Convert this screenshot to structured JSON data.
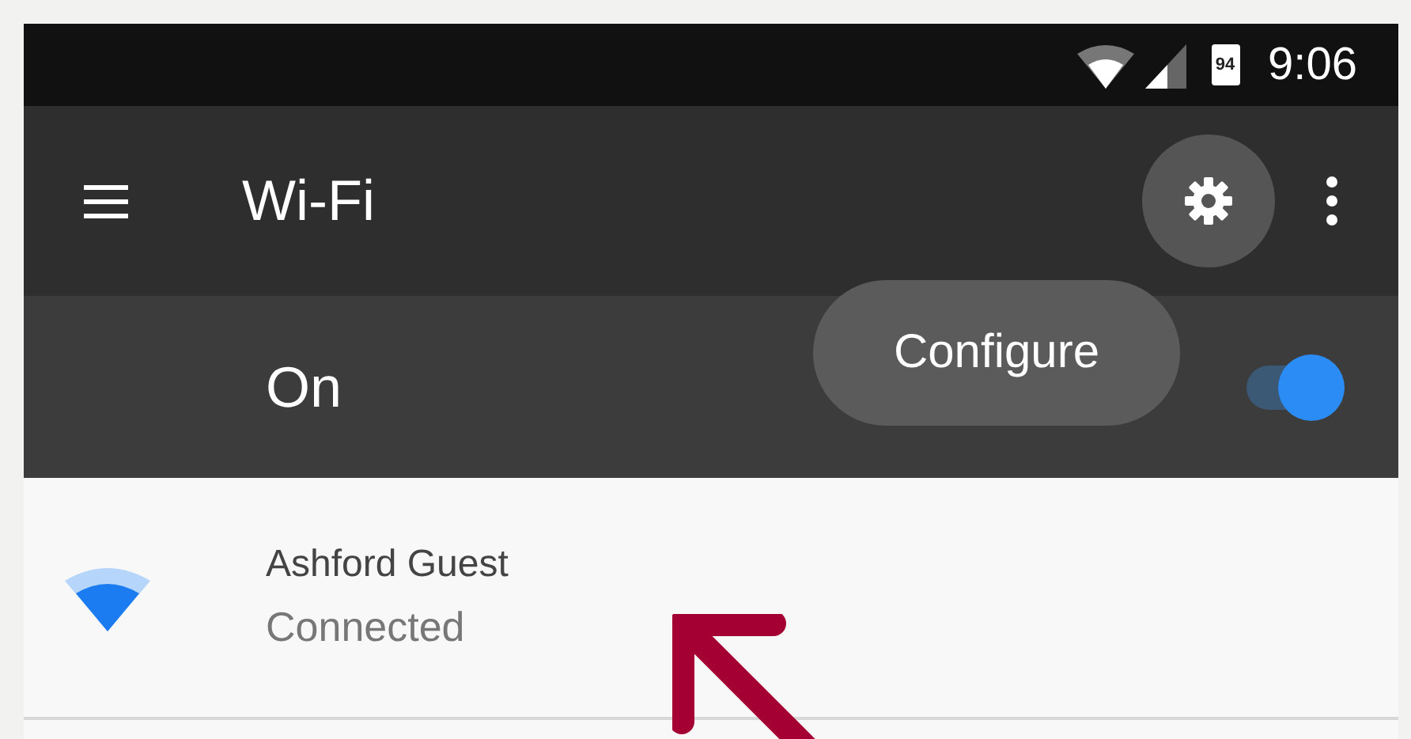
{
  "status_bar": {
    "battery": "94",
    "time": "9:06"
  },
  "toolbar": {
    "title": "Wi-Fi",
    "settings_pressed": true
  },
  "tooltip": {
    "text": "Configure"
  },
  "master_switch": {
    "label": "On",
    "on": true
  },
  "networks": [
    {
      "name": "Ashford Guest",
      "status": "Connected"
    }
  ],
  "annotation": {
    "kind": "arrow"
  }
}
